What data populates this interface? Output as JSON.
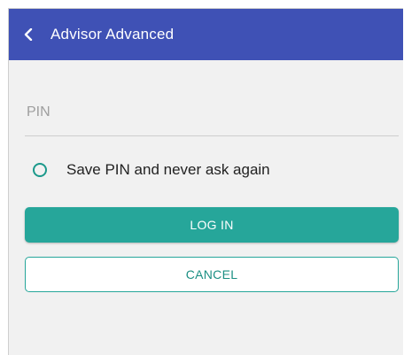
{
  "appbar": {
    "title": "Advisor Advanced",
    "back_icon": "chevron-left-icon"
  },
  "pin": {
    "placeholder": "PIN",
    "value": ""
  },
  "save_pin": {
    "label": "Save PIN and never ask again",
    "checked": false
  },
  "actions": {
    "login_label": "LOG IN",
    "cancel_label": "CANCEL"
  },
  "colors": {
    "appbar": "#3f51b5",
    "accent": "#26a69a",
    "background": "#f1f1f1"
  }
}
